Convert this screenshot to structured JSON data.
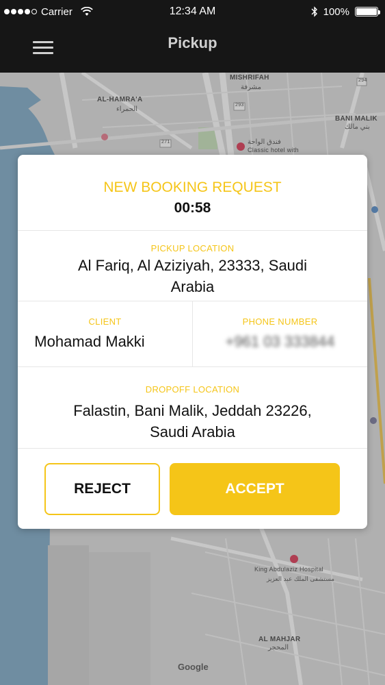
{
  "status_bar": {
    "carrier": "Carrier",
    "time": "12:34 AM",
    "battery": "100%",
    "battery_level": 1.0,
    "signal_bars": 4
  },
  "nav": {
    "title": "Pickup"
  },
  "map": {
    "labels": {
      "mishrifah": "MISHRIFAH",
      "mishrifah_ar": "مشرفة",
      "al_hamraa": "AL-HAMRA'A",
      "al_hamraa_ar": "الحمراء",
      "bani_malik": "BANI MALIK",
      "bani_malik_ar": "بني مالك",
      "hotel_ar": "فندق الواحة",
      "hotel_en": "Classic hotel with",
      "hospital_en": "King Abdulaziz Hospital",
      "hospital_ar": "مستشفى الملك عبد العزيز",
      "al_mahjar": "AL MAHJAR",
      "al_mahjar_ar": "المحجر",
      "road_294": "294",
      "road_293": "293",
      "road_271": "271",
      "google": "Google"
    }
  },
  "dialog": {
    "title": "NEW BOOKING REQUEST",
    "timer": "00:58",
    "pickup_label": "PICKUP LOCATION",
    "pickup_value": "Al Fariq, Al Aziziyah, 23333, Saudi Arabia",
    "client_label": "CLIENT",
    "client_value": "Mohamad Makki",
    "phone_label": "PHONE NUMBER",
    "phone_value": "+961 03 333844",
    "dropoff_label": "DROPOFF LOCATION",
    "dropoff_value": "Falastin, Bani Malik, Jeddah 23226, Saudi Arabia",
    "reject_label": "REJECT",
    "accept_label": "ACCEPT"
  },
  "colors": {
    "accent": "#f5c518",
    "nav_background": "#161616"
  }
}
